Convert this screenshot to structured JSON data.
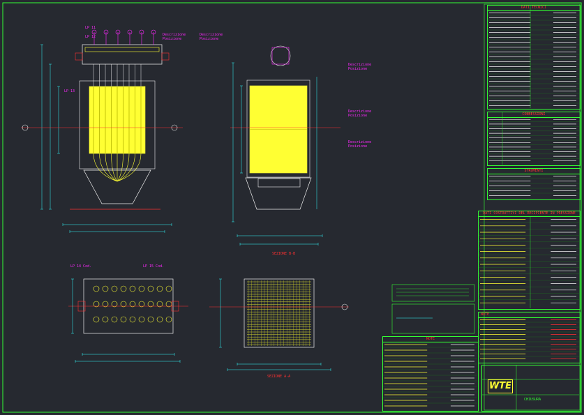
{
  "drawing": {
    "section_label_top": "SEZIONE B-B",
    "section_label_bottom": "SEZIONE A-A"
  },
  "tags_left": [
    {
      "text": "LP 11",
      "color": "#ff29ff"
    },
    {
      "text": "LP 12",
      "color": "#ff29ff"
    },
    {
      "text": "LP 13",
      "color": "#ff29ff"
    },
    {
      "text": "LP 14 Cod.",
      "color": "#ff29ff"
    },
    {
      "text": "LP 15 Cod.",
      "color": "#ff29ff"
    }
  ],
  "callouts_front": [
    {
      "title": "Descrizione",
      "value": "Posizione",
      "color": "#ff29ff"
    },
    {
      "title": "Descrizione",
      "value": "Posizione",
      "color": "#ff29ff"
    }
  ],
  "callouts_side": [
    {
      "title": "Descrizione",
      "value": "Posizione",
      "color": "#ff29ff"
    },
    {
      "title": "Descrizione",
      "value": "Posizione",
      "color": "#ff29ff"
    },
    {
      "title": "Descrizione",
      "value": "Posizione",
      "color": "#ff29ff"
    }
  ],
  "tables": {
    "dati_tecnici": {
      "title": "DATI TECNICI",
      "rows": 20
    },
    "connessioni": {
      "title": "CONNESSIONI",
      "subtitle": "DESCRIZIONE",
      "rows": 10
    },
    "strumenti": {
      "title": "STRUMENTI",
      "rows": 5
    },
    "caratteristiche": {
      "title": "DATI COSTRUTTIVI DEL RECIPIENTE IN PRESSIONE",
      "rows": 14
    },
    "note": {
      "title": "NOTE",
      "rows": 9
    },
    "note_generali": {
      "title": "NOTE",
      "rows": 8
    }
  },
  "centre_notes": {
    "box1_title": "",
    "box2_title": "",
    "box3_title": ""
  },
  "title_block": {
    "logo": "WTE",
    "line1": "CHIUSURA",
    "line2": "",
    "drawing_number": ""
  },
  "colors": {
    "background": "#262930",
    "frame": "#33ff33",
    "dimension": "#33ffff",
    "filter_body": "#ffff33",
    "magenta": "#ff29ff",
    "red": "#ff3030"
  }
}
